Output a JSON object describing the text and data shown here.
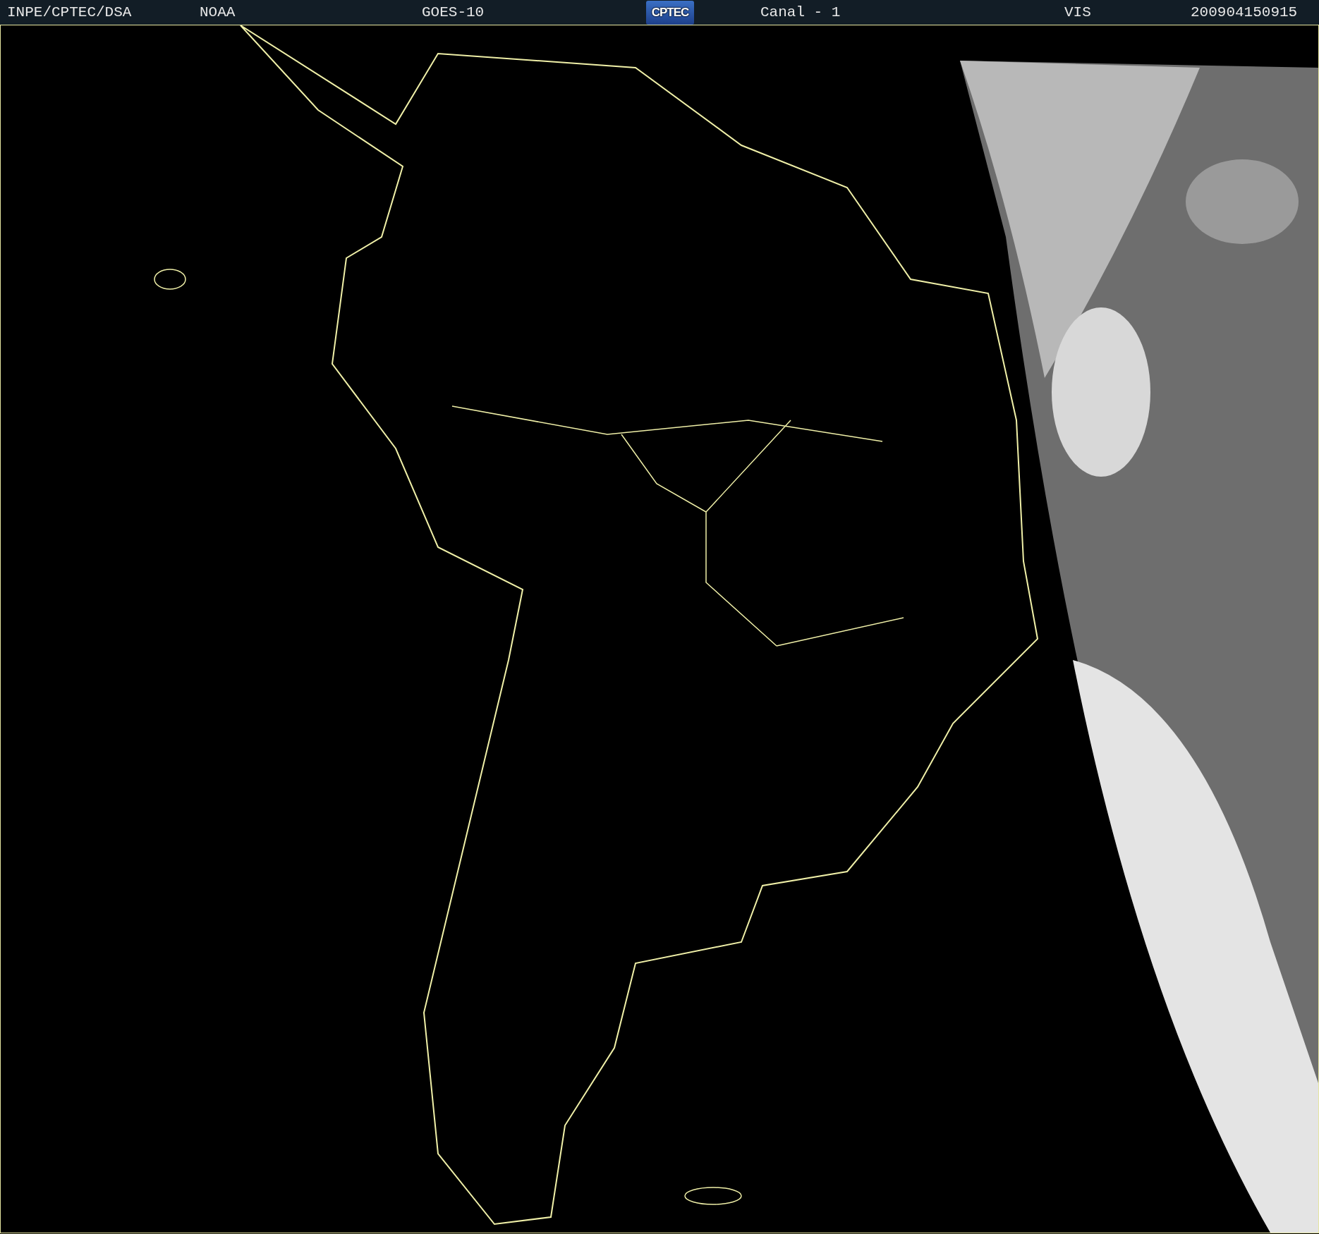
{
  "header": {
    "source": "INPE/CPTEC/DSA",
    "agency": "NOAA",
    "satellite": "GOES-10",
    "logo": "CPTEC",
    "channel": "Canal - 1",
    "band": "VIS",
    "timestamp": "200904150915"
  }
}
